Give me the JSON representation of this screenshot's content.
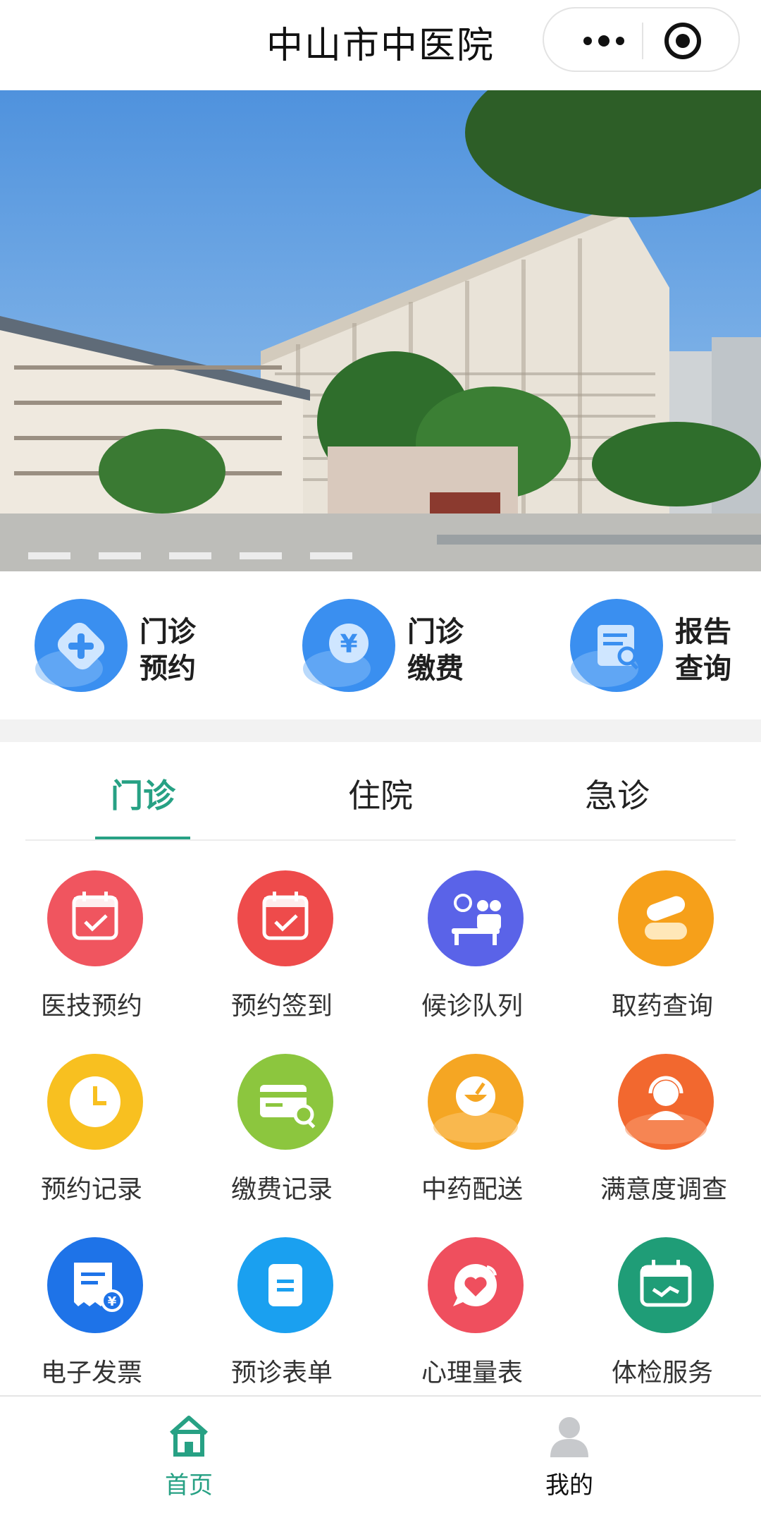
{
  "nav": {
    "title": "中山市中医院"
  },
  "quick_actions": [
    {
      "line1": "门诊",
      "line2": "预约",
      "icon": "plus-icon"
    },
    {
      "line1": "门诊",
      "line2": "缴费",
      "icon": "yuan-icon"
    },
    {
      "line1": "报告",
      "line2": "查询",
      "icon": "report-search-icon"
    }
  ],
  "tabs": [
    "门诊",
    "住院",
    "急诊"
  ],
  "active_tab": "门诊",
  "services": [
    {
      "label": "医技预约",
      "icon": "calendar-check-icon",
      "color": "#f0555f"
    },
    {
      "label": "预约签到",
      "icon": "calendar-check-icon",
      "color": "#ee4b4b"
    },
    {
      "label": "候诊队列",
      "icon": "waiting-queue-icon",
      "color": "#5a63e8"
    },
    {
      "label": "取药查询",
      "icon": "pills-icon",
      "color": "#f6a01a"
    },
    {
      "label": "预约记录",
      "icon": "clock-icon",
      "color": "#f8c020"
    },
    {
      "label": "缴费记录",
      "icon": "card-search-icon",
      "color": "#8cc63e"
    },
    {
      "label": "中药配送",
      "icon": "herb-bowl-icon",
      "color": "#f5a623"
    },
    {
      "label": "满意度调查",
      "icon": "customer-service-icon",
      "color": "#f2682f"
    },
    {
      "label": "电子发票",
      "icon": "invoice-icon",
      "color": "#1e73e8"
    },
    {
      "label": "预诊表单",
      "icon": "form-icon",
      "color": "#1aa0f0"
    },
    {
      "label": "心理量表",
      "icon": "heart-chat-icon",
      "color": "#ef4f5e"
    },
    {
      "label": "体检服务",
      "icon": "checkup-calendar-icon",
      "color": "#1f9d77"
    }
  ],
  "tabbar": [
    {
      "label": "首页",
      "icon": "home-icon",
      "active": true
    },
    {
      "label": "我的",
      "icon": "user-icon",
      "active": false
    }
  ],
  "colors": {
    "accent": "#27a184",
    "quick_icon": "#3a8ff0"
  }
}
